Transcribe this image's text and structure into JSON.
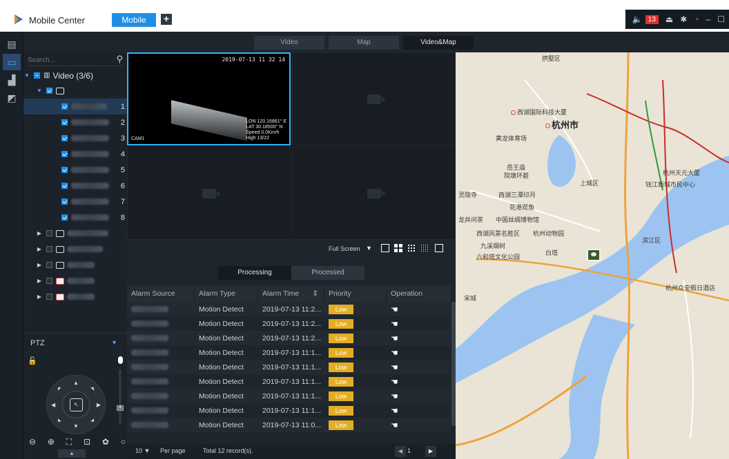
{
  "app": {
    "title": "Mobile Center",
    "mode_tab": "Mobile",
    "alarm_count": "13"
  },
  "view_tabs": [
    "Video",
    "Map",
    "Video&Map"
  ],
  "tree": {
    "search_placeholder": "Search...",
    "root_label": "Video (3/6)",
    "row_numbers": [
      "1",
      "2",
      "3",
      "4",
      "5",
      "6",
      "7",
      "8"
    ]
  },
  "ptz": {
    "title": "PTZ",
    "zoom_level": "4"
  },
  "video": {
    "timestamp": "2019-07-13 11 32 14",
    "cam_label": "CAM1",
    "osd_lines": [
      "LON 120.16861° E",
      "LAT 30.18500° N",
      "Speed 0.0Km/h",
      "High 13/22"
    ]
  },
  "toolbar": {
    "fullscreen_label": "Full Screen"
  },
  "alarm_tabs": [
    "Processing",
    "Processed"
  ],
  "table": {
    "headers": [
      "Alarm Source",
      "Alarm Type",
      "Alarm Time",
      "Priority",
      "Operation"
    ],
    "rows": [
      {
        "type": "Motion Detect",
        "time": "2019-07-13 11:2...",
        "priority": "Low"
      },
      {
        "type": "Motion Detect",
        "time": "2019-07-13 11:2...",
        "priority": "Low"
      },
      {
        "type": "Motion Detect",
        "time": "2019-07-13 11:2...",
        "priority": "Low"
      },
      {
        "type": "Motion Detect",
        "time": "2019-07-13 11:1...",
        "priority": "Low"
      },
      {
        "type": "Motion Detect",
        "time": "2019-07-13 11:1...",
        "priority": "Low"
      },
      {
        "type": "Motion Detect",
        "time": "2019-07-13 11:1...",
        "priority": "Low"
      },
      {
        "type": "Motion Detect",
        "time": "2019-07-13 11:1...",
        "priority": "Low"
      },
      {
        "type": "Motion Detect",
        "time": "2019-07-13 11:1...",
        "priority": "Low"
      },
      {
        "type": "Motion Detect",
        "time": "2019-07-13 11:0...",
        "priority": "Low"
      }
    ]
  },
  "pager": {
    "page_size": "10",
    "per_page_label": "Per page",
    "total": "Total 12 record(s).",
    "current_page": "1"
  },
  "map": {
    "labels": [
      "拱墅区",
      "西湖国际科技大厦",
      "杭州市",
      "黄龙体育场",
      "岳王庙",
      "院墩环碧",
      "上城区",
      "灵隐寺",
      "西湖三潭印月",
      "花港观鱼",
      "龙井问茶",
      "中国丝绸博物馆",
      "西湖风景名胜区",
      "杭州动物园",
      "九溪烟树",
      "六和塔文化公园",
      "白塔",
      "滨江区",
      "钱江新城市民中心",
      "杭州天元大厦",
      "宋城",
      "杭州众安假日酒店"
    ],
    "accent_road": "#f0a23a",
    "river": "#9dc4f0"
  },
  "colors": {
    "accent": "#1f8fe6",
    "priority_low": "#e3ae22",
    "selection": "#33b5f4"
  }
}
